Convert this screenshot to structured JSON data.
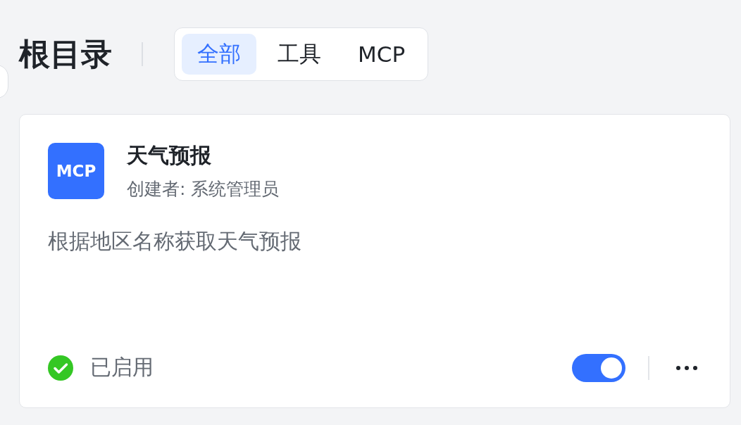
{
  "header": {
    "title": "根目录"
  },
  "tabs": [
    {
      "label": "全部",
      "selected": true
    },
    {
      "label": "工具",
      "selected": false
    },
    {
      "label": "MCP",
      "selected": false
    }
  ],
  "cards": [
    {
      "badge": "MCP",
      "title": "天气预报",
      "creator": "创建者: 系统管理员",
      "description": "根据地区名称获取天气预报",
      "status": "已启用",
      "enabled": true
    }
  ]
}
